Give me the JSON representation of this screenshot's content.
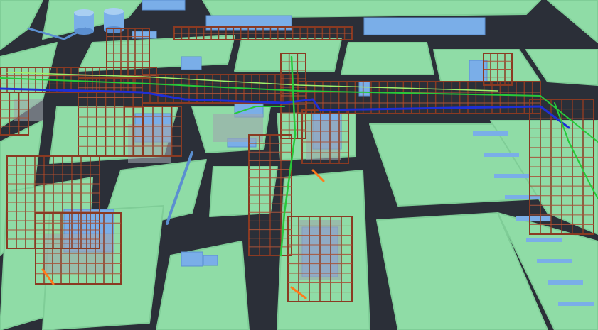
{
  "scene": {
    "colors": {
      "road": "#2b2f38",
      "ground": "#8fdca6",
      "ground_edge": "#7fcd97",
      "steel": "#8a3a22",
      "steel_light": "#a8543a",
      "pipe_blue": "#1e2fd6",
      "pipe_green": "#27c93a",
      "pipe_lightgreen": "#9ef06a",
      "equipment": "#7aaee8",
      "equipment_dark": "#5b8fd0",
      "platform": "#9fa7ad",
      "orange": "#ff7a1a"
    }
  }
}
